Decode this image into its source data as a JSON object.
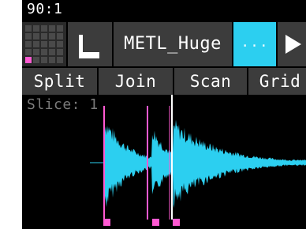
{
  "title": "90:1",
  "toolbar": {
    "grid_icon": "grid-icon",
    "mode_icon": "one-shot-icon",
    "sample_name": "METL_Huge",
    "more_label": "...",
    "play_icon": "play-icon"
  },
  "actions": {
    "split": "Split",
    "join": "Join",
    "scan": "Scan",
    "grid": "Grid"
  },
  "waveform": {
    "slice_label": "Slice: 1",
    "slice_marker_count": 3,
    "selected_slice": 1
  },
  "colors": {
    "background": "#000000",
    "button": "#3c3c3c",
    "accent_cyan": "#2ccff0",
    "marker_pink": "#ff5ad2",
    "waveform": "#2ccff0",
    "label_gray": "#7a7a7a"
  }
}
